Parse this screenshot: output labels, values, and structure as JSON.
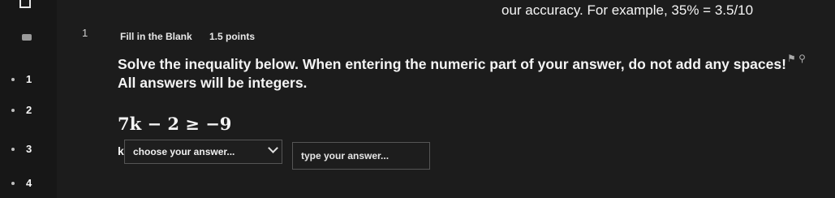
{
  "top_text": "our accuracy. For example, 35% = 3.5/10",
  "question": {
    "number": "1",
    "type": "Fill in the Blank",
    "points": "1.5 points",
    "prompt": "Solve the inequality below. When entering the numeric part of your answer, do not add any spaces! All answers will be integers.",
    "inequality": "7k − 2 ≥ −9",
    "variable_label": "k",
    "select_placeholder": "choose your answer...",
    "input_placeholder": "type your answer..."
  },
  "sidebar": {
    "questions": [
      "1",
      "2",
      "3",
      "4"
    ]
  }
}
